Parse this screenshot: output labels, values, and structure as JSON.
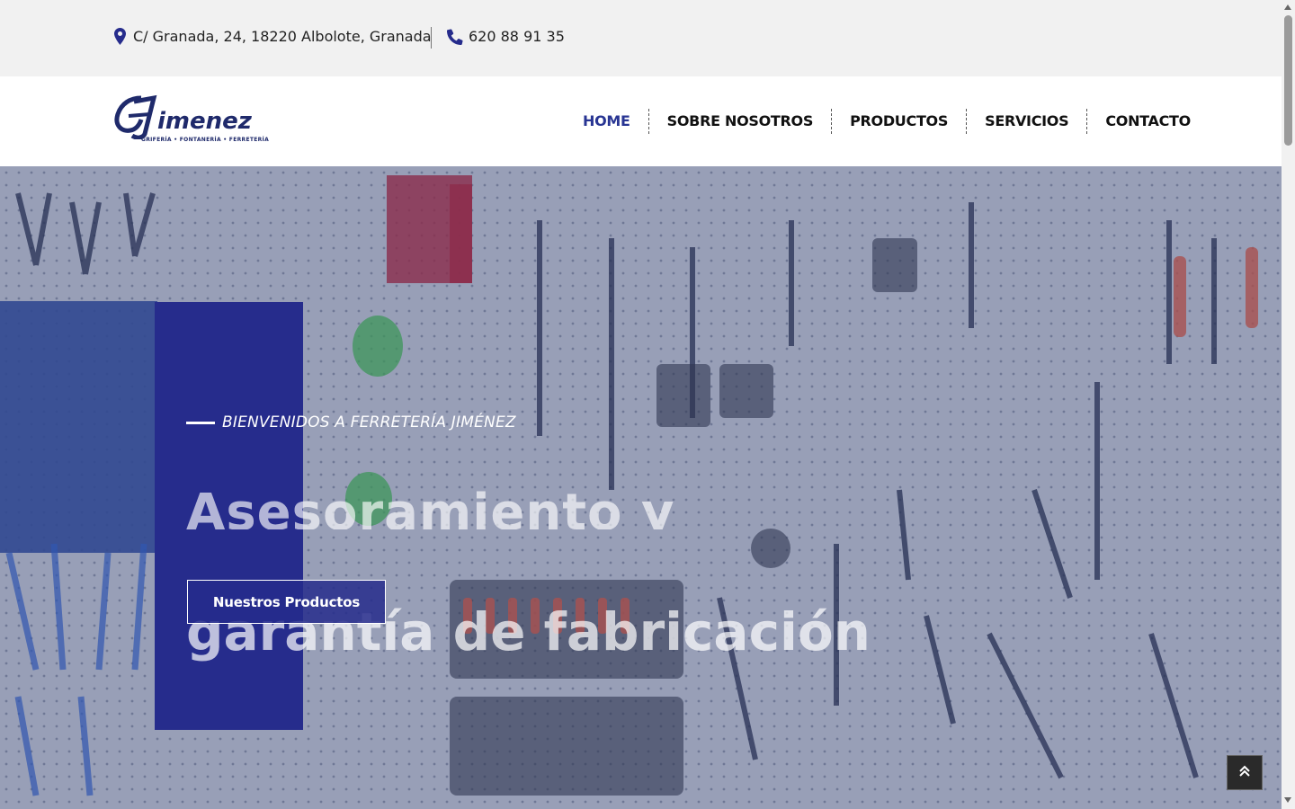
{
  "topbar": {
    "address": "C/ Granada, 24, 18220 Albolote, Granada",
    "phone": "620 88 91 35",
    "address_icon": "map-pin-icon",
    "phone_icon": "phone-icon"
  },
  "header": {
    "logo_text": "Jimenez",
    "logo_tagline": "GRIFERÍA • FONTANERÍA • FERRETERÍA",
    "nav": [
      {
        "label": "HOME"
      },
      {
        "label": "SOBRE NOSOTROS"
      },
      {
        "label": "PRODUCTOS"
      },
      {
        "label": "SERVICIOS"
      },
      {
        "label": "CONTACTO"
      }
    ]
  },
  "hero": {
    "welcome": "BIENVENIDOS A FERRETERÍA JIMÉNEZ",
    "headline_line1": "Asesoramiento y",
    "headline_line2": "garantía de fabricación",
    "button_label": "Nuestros Productos"
  },
  "colors": {
    "brand": "#262c8c",
    "nav_active": "#283593"
  },
  "back_to_top_icon": "double-chevron-up-icon"
}
